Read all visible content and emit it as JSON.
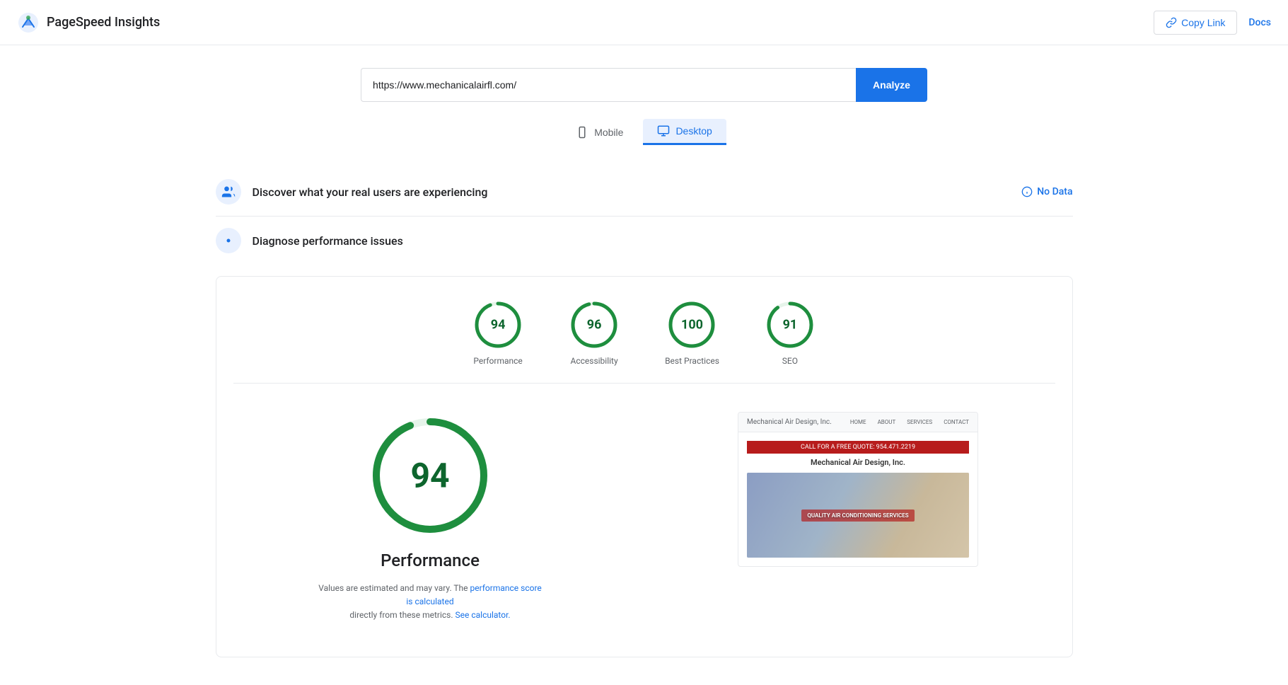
{
  "header": {
    "logo_alt": "PageSpeed Insights logo",
    "title": "PageSpeed Insights",
    "copy_link_label": "Copy Link",
    "docs_label": "Docs"
  },
  "url_bar": {
    "url_value": "https://www.mechanicalairfl.com/",
    "analyze_label": "Analyze"
  },
  "device_toggle": {
    "mobile_label": "Mobile",
    "desktop_label": "Desktop",
    "active": "desktop"
  },
  "real_users_section": {
    "icon": "users-icon",
    "title": "Discover what your real users are experiencing",
    "badge_label": "No Data"
  },
  "diagnose_section": {
    "icon": "diagnose-icon",
    "title": "Diagnose performance issues"
  },
  "scores": [
    {
      "label": "Performance",
      "value": "94",
      "color": "#0d652d",
      "stroke": "#1e8e3e"
    },
    {
      "label": "Accessibility",
      "value": "96",
      "color": "#0d652d",
      "stroke": "#1e8e3e"
    },
    {
      "label": "Best Practices",
      "value": "100",
      "color": "#0d652d",
      "stroke": "#1e8e3e"
    },
    {
      "label": "SEO",
      "value": "91",
      "color": "#0d652d",
      "stroke": "#1e8e3e"
    }
  ],
  "large_score": {
    "value": "94",
    "title": "Performance",
    "description_prefix": "Values are estimated and may vary. The",
    "description_link1": "performance score is calculated",
    "description_link1_suffix": "",
    "description_middle": "directly from these metrics.",
    "description_link2": "See calculator.",
    "score_color": "#0d652d",
    "stroke_color": "#1e8e3e"
  },
  "screenshot": {
    "brand": "Mechanical Air Design, Inc.",
    "nav_items": [
      "HOME",
      "ABOUT",
      "SERVICES",
      "CONTACT"
    ],
    "call_text": "CALL FOR A FREE QUOTE: 954.471.2219",
    "tagline": "QUALITY AIR CONDITIONING SERVICES"
  },
  "colors": {
    "accent": "#1a73e8",
    "green": "#1e8e3e",
    "green_light": "#e6f4ea",
    "green_dark": "#0d652d",
    "border": "#e8eaed",
    "text_secondary": "#5f6368"
  }
}
